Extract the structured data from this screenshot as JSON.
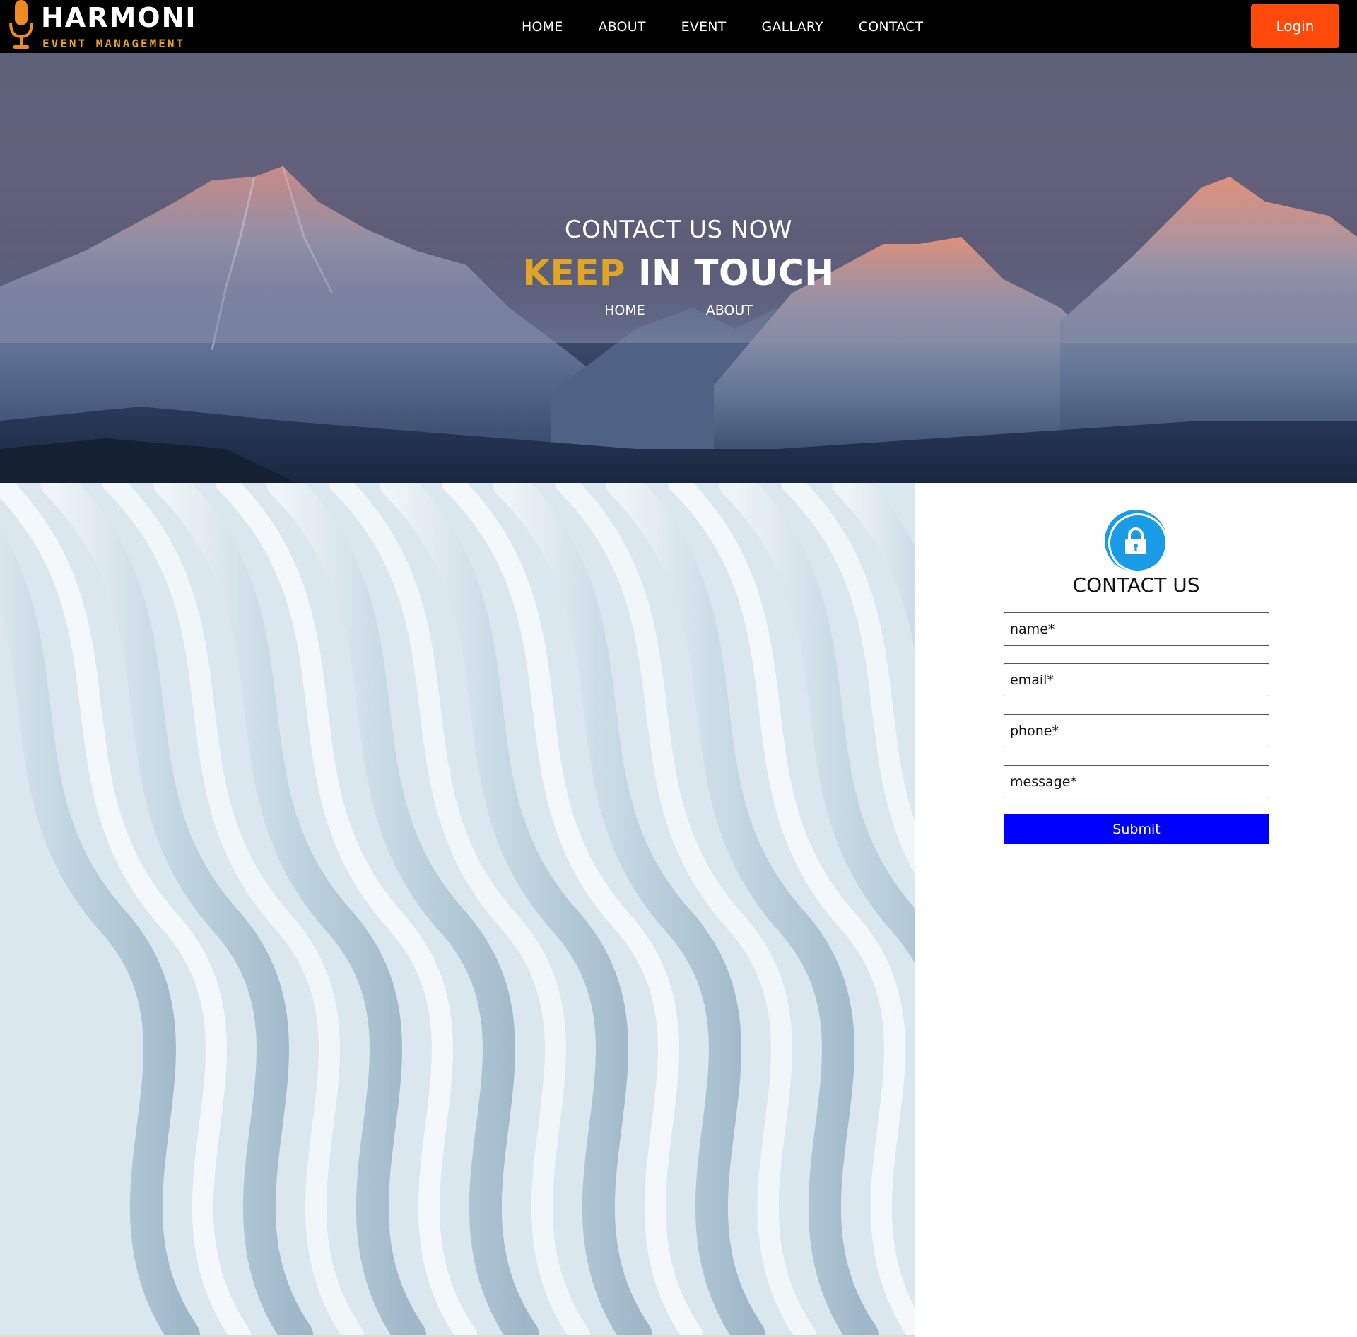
{
  "brand": {
    "name": "HARMONI",
    "tagline": "EVENT MANAGEMENT",
    "accent_color": "#e8a317",
    "logo_icon": "microphone-icon"
  },
  "nav": {
    "items": [
      {
        "label": "HOME"
      },
      {
        "label": "ABOUT"
      },
      {
        "label": "EVENT"
      },
      {
        "label": "GALLARY"
      },
      {
        "label": "CONTACT"
      }
    ],
    "login_label": "Login",
    "login_color": "#ff4a0c"
  },
  "hero": {
    "subtitle": "CONTACT US NOW",
    "title_accent": "KEEP",
    "title_rest": "IN TOUCH",
    "accent_color": "#e0a524",
    "crumbs": [
      {
        "label": "HOME"
      },
      {
        "label": "ABOUT"
      }
    ],
    "background": "snowy-mountains-at-dusk"
  },
  "contact": {
    "icon": "lock-icon",
    "icon_color": "#1a9be6",
    "title": "CONTACT US",
    "fields": {
      "name_placeholder": "name*",
      "email_placeholder": "email*",
      "phone_placeholder": "phone*",
      "message_placeholder": "message*"
    },
    "submit_label": "Submit",
    "submit_color": "#0000ff"
  },
  "side_image": "abstract-white-waves"
}
